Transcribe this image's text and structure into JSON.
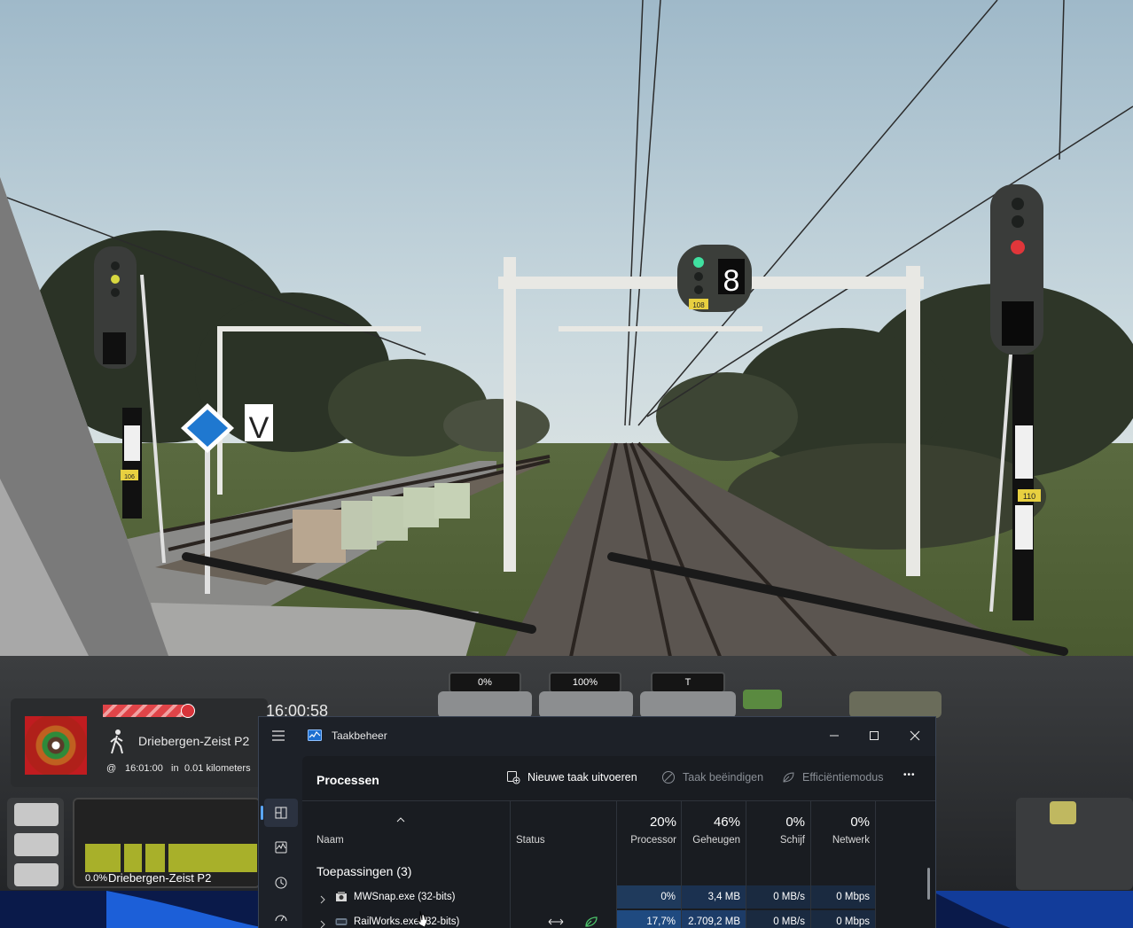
{
  "hud": {
    "clock": "16:00:58",
    "station": "Driebergen-Zeist P2",
    "eta_prefix": "@",
    "eta_time": "16:01:00",
    "eta_in": "in",
    "eta_distance": "0.01 kilometers",
    "progress_pct": "0.0%",
    "progress_station": "Driebergen-Zeist P2",
    "slot_boxes": [
      "0%",
      "100%",
      "T"
    ]
  },
  "scene": {
    "signal_number": "8",
    "signal_plate_center": "108",
    "signal_plate_left": "106",
    "signal_plate_right": "110",
    "v_sign": "V"
  },
  "taskmgr": {
    "title": "Taakbeheer",
    "section_title": "Processen",
    "cmd_new_task": "Nieuwe taak uitvoeren",
    "cmd_end_task": "Taak beëindigen",
    "cmd_efficiency": "Efficiëntiemodus",
    "cmd_more": "•••",
    "columns": {
      "name": "Naam",
      "status": "Status",
      "cpu_pct": "20%",
      "cpu_label": "Processor",
      "mem_pct": "46%",
      "mem_label": "Geheugen",
      "disk_pct": "0%",
      "disk_label": "Schijf",
      "net_pct": "0%",
      "net_label": "Netwerk"
    },
    "group_label": "Toepassingen (3)",
    "rows": [
      {
        "name": "MWSnap.exe (32-bits)",
        "cpu": "0%",
        "mem": "3,4 MB",
        "disk": "0 MB/s",
        "net": "0 Mbps"
      },
      {
        "name": "RailWorks.exe (32-bits)",
        "cpu": "17,7%",
        "mem": "2.709,2 MB",
        "disk": "0 MB/s",
        "net": "0 Mbps"
      }
    ]
  }
}
